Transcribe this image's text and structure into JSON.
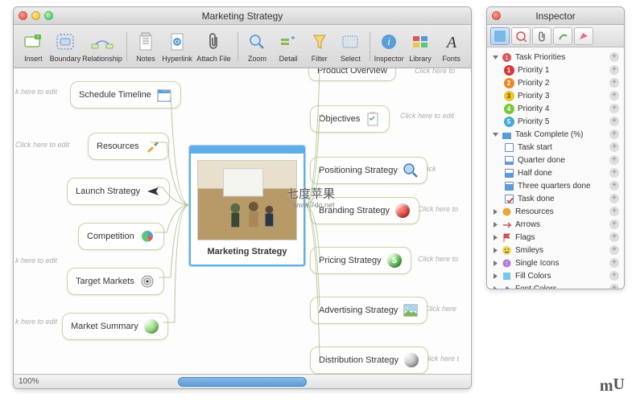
{
  "main": {
    "title": "Marketing Strategy",
    "toolbar": [
      {
        "label": "Insert",
        "icon": "insert"
      },
      {
        "label": "Boundary",
        "icon": "boundary"
      },
      {
        "label": "Relationship",
        "icon": "relationship"
      },
      {
        "label": "Notes",
        "icon": "notes"
      },
      {
        "label": "Hyperlink",
        "icon": "hyperlink"
      },
      {
        "label": "Attach File",
        "icon": "attach"
      },
      {
        "label": "Zoom",
        "icon": "zoom"
      },
      {
        "label": "Detail",
        "icon": "detail"
      },
      {
        "label": "Filter",
        "icon": "filter"
      },
      {
        "label": "Select",
        "icon": "select"
      },
      {
        "label": "Inspector",
        "icon": "inspector"
      },
      {
        "label": "Library",
        "icon": "library"
      },
      {
        "label": "Fonts",
        "icon": "fonts"
      }
    ],
    "center_label": "Marketing Strategy",
    "left_nodes": [
      {
        "label": "Schedule Timeline"
      },
      {
        "label": "Resources"
      },
      {
        "label": "Launch Strategy"
      },
      {
        "label": "Competition"
      },
      {
        "label": "Target Markets"
      },
      {
        "label": "Market Summary"
      }
    ],
    "right_nodes": [
      {
        "label": "Product Overview"
      },
      {
        "label": "Objectives"
      },
      {
        "label": "Positioning Strategy"
      },
      {
        "label": "Branding Strategy"
      },
      {
        "label": "Pricing Strategy"
      },
      {
        "label": "Advertising Strategy"
      },
      {
        "label": "Distribution Strategy"
      }
    ],
    "hint_text": "Click here to edit",
    "hint_text_short": "k here to edit",
    "hint_text_r": "Click here to",
    "zoom": "100%"
  },
  "inspector": {
    "title": "Inspector",
    "groups": [
      {
        "label": "Task Priorities",
        "expanded": true,
        "children": [
          {
            "label": "Priority 1",
            "p": 1
          },
          {
            "label": "Priority 2",
            "p": 2
          },
          {
            "label": "Priority 3",
            "p": 3
          },
          {
            "label": "Priority 4",
            "p": 4
          },
          {
            "label": "Priority 5",
            "p": 5
          }
        ]
      },
      {
        "label": "Task Complete (%)",
        "expanded": true,
        "children": [
          {
            "label": "Task start",
            "c": 0
          },
          {
            "label": "Quarter done",
            "c": 25
          },
          {
            "label": "Half done",
            "c": 50
          },
          {
            "label": "Three quarters done",
            "c": 75
          },
          {
            "label": "Task done",
            "c": 100
          }
        ]
      },
      {
        "label": "Resources",
        "expanded": false
      },
      {
        "label": "Arrows",
        "expanded": false
      },
      {
        "label": "Flags",
        "expanded": false
      },
      {
        "label": "Smileys",
        "expanded": false
      },
      {
        "label": "Single Icons",
        "expanded": false
      },
      {
        "label": "Fill Colors",
        "expanded": false
      },
      {
        "label": "Font Colors",
        "expanded": false
      }
    ]
  },
  "watermark": {
    "main": "七度苹果",
    "sub": "www.7do.net"
  }
}
